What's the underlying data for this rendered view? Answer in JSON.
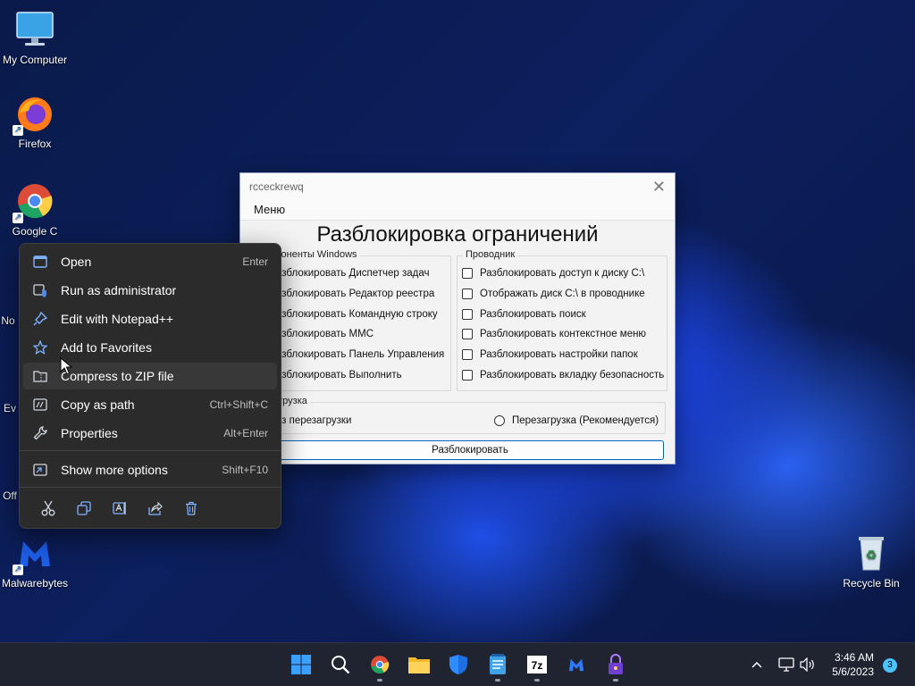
{
  "desktop": {
    "icons": [
      {
        "label": "My Computer"
      },
      {
        "label": "Firefox"
      },
      {
        "label": "Google C"
      },
      {
        "label": "No"
      },
      {
        "label": "Ev"
      },
      {
        "label": "Off"
      },
      {
        "label": "Malwarebytes"
      },
      {
        "label": "Recycle Bin"
      }
    ]
  },
  "app_window": {
    "title": "rcceckrewq",
    "menu": "Меню",
    "heading": "Разблокировка ограничений",
    "group_windows": {
      "legend": "мпоненты Windows",
      "options": [
        "азблокировать Диспетчер задач",
        "азблокировать Редактор реестра",
        "азблокировать Командную строку",
        "азблокировать MMC",
        "азблокировать Панель Управления",
        "азблокировать Выполнить"
      ]
    },
    "group_explorer": {
      "legend": "Проводник",
      "options": [
        "Разблокировать доступ к диску C:\\",
        "Отображать диск C:\\ в проводнике",
        "Разблокировать поиск",
        "Разблокировать контекстное меню",
        "Разблокировать настройки папок",
        "Разблокировать вкладку безопасность"
      ]
    },
    "group_reboot": {
      "legend": "загрузка",
      "no_reboot": "ез перезагрузки",
      "reboot": "Перезагрузка (Рекомендуется)"
    },
    "button": "Разблокировать"
  },
  "context_menu": {
    "items": [
      {
        "label": "Open",
        "shortcut": "Enter",
        "icon": "window-icon"
      },
      {
        "label": "Run as administrator",
        "shortcut": "",
        "icon": "shield-icon"
      },
      {
        "label": "Edit with Notepad++",
        "shortcut": "",
        "icon": "pin-icon"
      },
      {
        "label": "Add to Favorites",
        "shortcut": "",
        "icon": "star-icon"
      },
      {
        "label": "Compress to ZIP file",
        "shortcut": "",
        "icon": "zip-folder-icon"
      },
      {
        "label": "Copy as path",
        "shortcut": "Ctrl+Shift+C",
        "icon": "copy-path-icon"
      },
      {
        "label": "Properties",
        "shortcut": "Alt+Enter",
        "icon": "wrench-icon"
      },
      {
        "label": "Show more options",
        "shortcut": "Shift+F10",
        "icon": "more-options-icon"
      }
    ],
    "toolbar": [
      "cut-icon",
      "copy-icon",
      "rename-icon",
      "share-icon",
      "delete-icon"
    ]
  },
  "taskbar": {
    "apps": [
      "start-icon",
      "search-icon",
      "chrome-icon",
      "file-explorer-icon",
      "defender-icon",
      "notepad-icon",
      "7zip-icon",
      "malwarebytes-icon",
      "lock-app-icon"
    ],
    "zip_label": "7z",
    "time": "3:46 AM",
    "date": "5/6/2023",
    "notifications": "3"
  },
  "colors": {
    "accent": "#0067c0",
    "menu_bg": "#2b2b2b",
    "taskbar_bg": "#1f2430"
  }
}
